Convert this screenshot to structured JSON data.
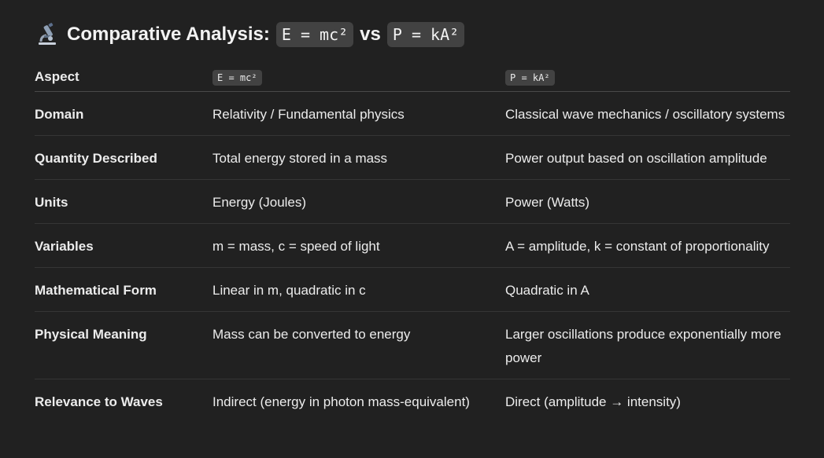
{
  "heading": {
    "title": "Comparative Analysis:",
    "code1": "E = mc²",
    "vs": "vs",
    "code2": "P = kA²",
    "icon": "microscope-icon"
  },
  "table": {
    "headers": [
      "Aspect",
      "E = mc²",
      "P = kA²"
    ],
    "rows": [
      [
        "Domain",
        "Relativity / Fundamental physics",
        "Classical wave mechanics / oscillatory systems"
      ],
      [
        "Quantity Described",
        "Total energy stored in a mass",
        "Power output based on oscillation amplitude"
      ],
      [
        "Units",
        "Energy (Joules)",
        "Power (Watts)"
      ],
      [
        "Variables",
        "m = mass, c = speed of light",
        "A = amplitude, k = constant of proportionality"
      ],
      [
        "Mathematical Form",
        "Linear in m, quadratic in c",
        "Quadratic in A"
      ],
      [
        "Physical Meaning",
        "Mass can be converted to energy",
        "Larger oscillations produce exponentially more power"
      ],
      [
        "Relevance to Waves",
        "Indirect (energy in photon mass-equivalent)",
        "Direct (amplitude → intensity)"
      ]
    ]
  },
  "colors": {
    "background": "#212121",
    "code_background": "#424242",
    "text": "#ececec"
  }
}
